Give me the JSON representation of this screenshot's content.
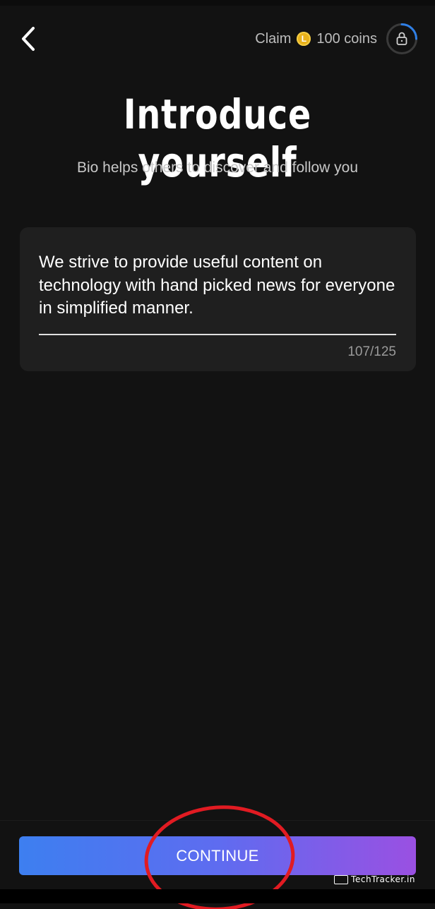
{
  "header": {
    "back_icon": "chevron-left-icon",
    "claim_label": "Claim",
    "coin_icon": "coin-icon",
    "coin_symbol": "L",
    "coins_text": "100 coins",
    "lock_icon": "lock-icon",
    "progress_fraction": 0.25
  },
  "main": {
    "title": "Introduce yourself",
    "subtitle": "Bio helps others to discover and follow you"
  },
  "bio": {
    "value": "We strive to provide useful content on technology with hand picked news for everyone in simplified manner.",
    "counter": "107/125"
  },
  "footer": {
    "continue_label": "CONTINUE"
  },
  "watermark": {
    "text": "TechTracker.in"
  },
  "colors": {
    "background": "#121212",
    "card": "#1f1f1f",
    "button_gradient_start": "#3d7ff0",
    "button_gradient_end": "#9a50e2",
    "coin": "#e8b11b",
    "progress_ring": "#2f7fe6",
    "annotation": "#e11b22"
  }
}
